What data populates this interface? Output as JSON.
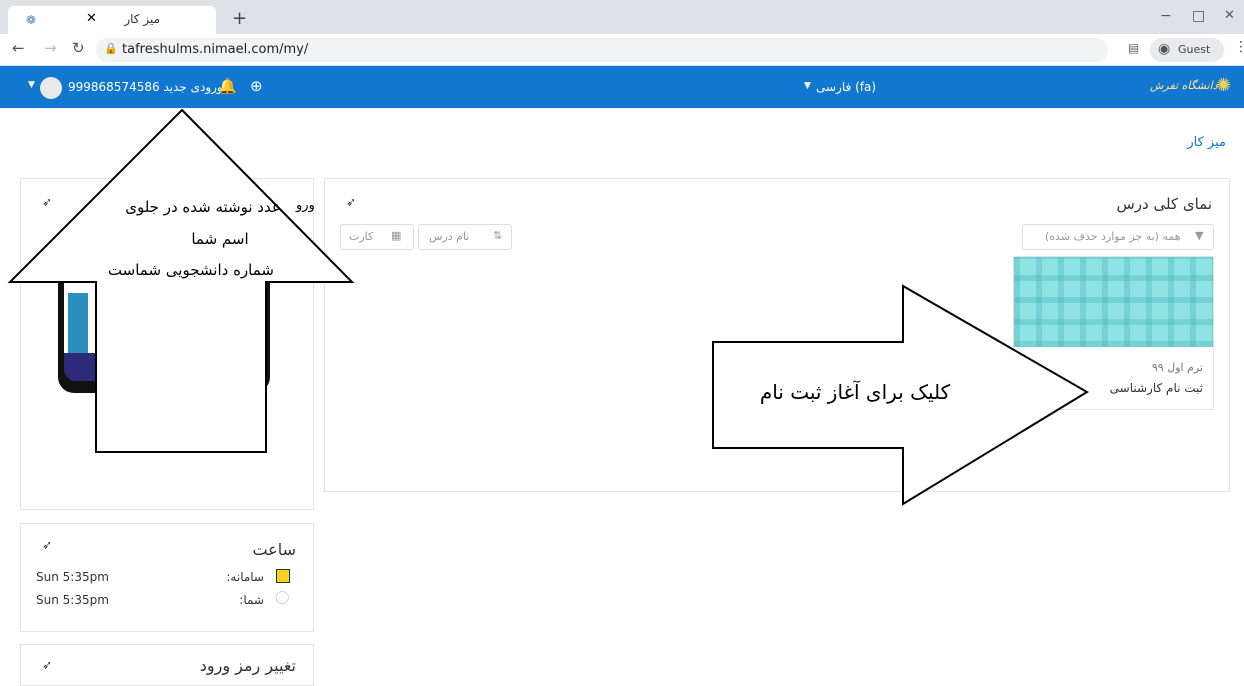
{
  "browser": {
    "tab_title": "میز کار",
    "new_tab": "+",
    "url": "tafreshulms.nimael.com/my/",
    "profile": "Guest",
    "window_controls": [
      "−",
      "□",
      "✕"
    ]
  },
  "navbar": {
    "logo_text": "دانشگاه تفرش",
    "language": "فارسی (fa)",
    "user_name": "ورودی جدید 999868574586"
  },
  "breadcrumb": "میز کار",
  "course_overview": {
    "title": "نمای کلی درس",
    "filter": "همه (به جز موارد حذف شده)",
    "sort": "نام درس",
    "view": "کارت",
    "course_term": "ترم اول ۹۹",
    "course_name": "ثبت نام کارشناسی"
  },
  "clock": {
    "title": "ساعت",
    "rows": [
      {
        "label": "سامانه:",
        "time": "Sun 5:35pm"
      },
      {
        "label": "شما:",
        "time": "Sun 5:35pm"
      }
    ]
  },
  "password_block": {
    "title": "تغییر رمز ورود"
  },
  "annotations": {
    "up_arrow_lines": [
      "عدد نوشته شده در جلوی",
      "اسم شما",
      "شماره دانشجویی شماست"
    ],
    "right_arrow_text": "کلیک برای آغاز ثبت نام",
    "partial_block_text": "ورو"
  },
  "colors": {
    "navbar": "#1177d1",
    "link": "#1177d1",
    "course_image": "#8fe3e3"
  },
  "icons": [
    "lock-icon",
    "translate-icon",
    "guest-avatar-icon",
    "menu-icon",
    "bell-icon",
    "download-icon",
    "pin-icon",
    "filter-icon",
    "grid-icon",
    "sort-icon"
  ]
}
